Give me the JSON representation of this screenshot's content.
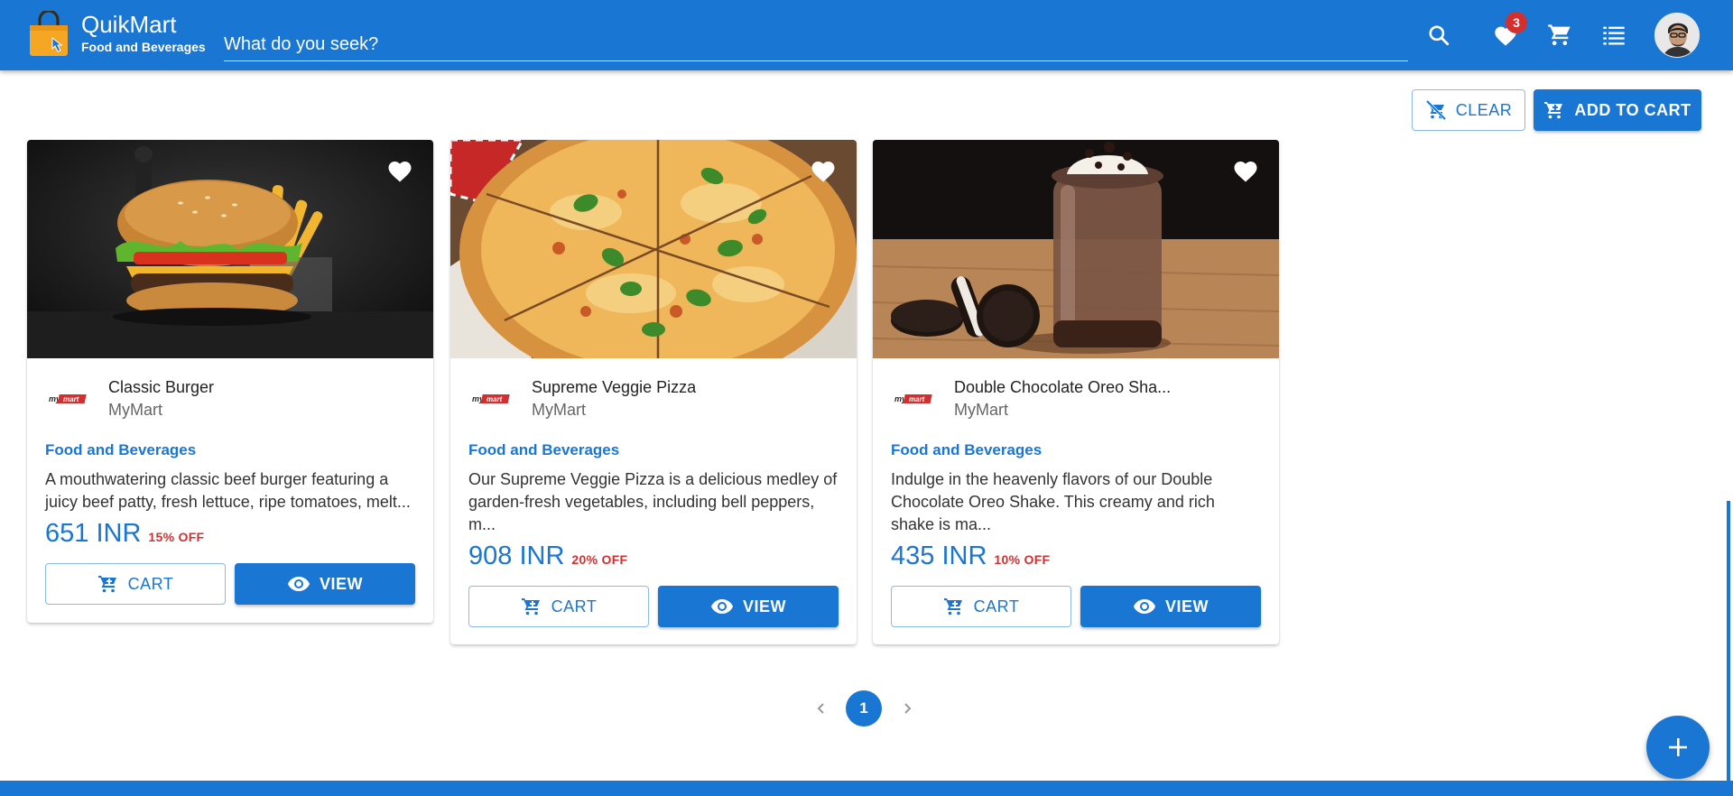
{
  "app": {
    "name": "QuikMart",
    "subtitle": "Food and Beverages",
    "search_placeholder": "What do you seek?",
    "wishlist_count": "3",
    "accent_color": "#1976d2",
    "badge_color": "#d32f2f"
  },
  "toolbar": {
    "clear_label": "CLEAR",
    "add_to_cart_label": "ADD TO CART"
  },
  "products": [
    {
      "title": "Classic Burger",
      "seller": "MyMart",
      "category": "Food and Beverages",
      "description": "A mouthwatering classic beef burger featuring a juicy beef patty, fresh lettuce, ripe tomatoes, melt...",
      "price": "651 INR",
      "discount": "15% OFF",
      "cart_label": "CART",
      "view_label": "VIEW",
      "image": "burger"
    },
    {
      "title": "Supreme Veggie Pizza",
      "seller": "MyMart",
      "category": "Food and Beverages",
      "description": "Our Supreme Veggie Pizza is a delicious medley of garden-fresh vegetables, including bell peppers, m...",
      "price": "908 INR",
      "discount": "20% OFF",
      "cart_label": "CART",
      "view_label": "VIEW",
      "image": "pizza"
    },
    {
      "title": "Double Chocolate Oreo Sha...",
      "seller": "MyMart",
      "category": "Food and Beverages",
      "description": "Indulge in the heavenly flavors of our Double Chocolate Oreo Shake. This creamy and rich shake is ma...",
      "price": "435 INR",
      "discount": "10% OFF",
      "cart_label": "CART",
      "view_label": "VIEW",
      "image": "shake"
    }
  ],
  "pagination": {
    "current_page": "1",
    "prev_icon": "chevron-left-icon",
    "next_icon": "chevron-right-icon"
  },
  "icons": {
    "search": "search-icon",
    "wishlist": "heart-icon",
    "cart": "cart-icon",
    "orders": "list-icon",
    "fab": "plus-icon"
  }
}
